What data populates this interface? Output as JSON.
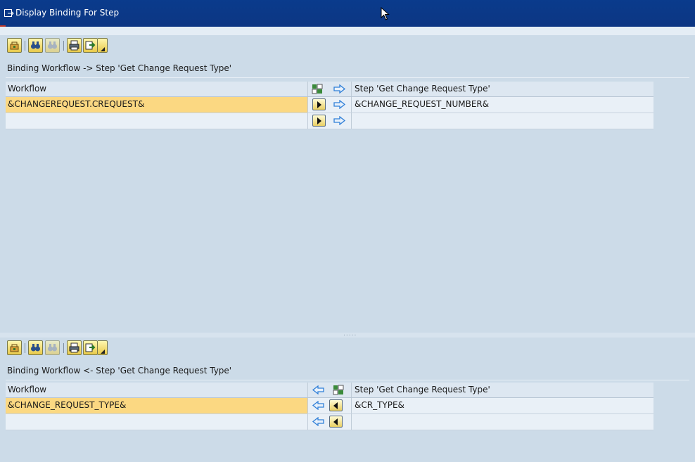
{
  "window": {
    "title": "Display Binding For Step"
  },
  "panels": [
    {
      "id": "import",
      "toolbar": [
        "details-icon",
        "find-icon",
        "find-next-icon",
        "print-icon",
        "export-icon"
      ],
      "binding_label": "Binding Workflow  -> Step 'Get Change Request Type'",
      "header": {
        "left": "Workflow",
        "right": "Step 'Get Change Request Type'"
      },
      "rows": [
        {
          "left": "&CHANGEREQUEST.CREQUEST&",
          "right": "&CHANGE_REQUEST_NUMBER&",
          "selected": true
        },
        {
          "left": "",
          "right": "",
          "selected": false
        }
      ]
    },
    {
      "id": "export",
      "toolbar": [
        "details-icon",
        "find-icon",
        "find-next-icon",
        "print-icon",
        "export-icon"
      ],
      "binding_label": "Binding Workflow  <- Step 'Get Change Request Type'",
      "header": {
        "left": "Workflow",
        "right": "Step 'Get Change Request Type'"
      },
      "rows": [
        {
          "left": "&CHANGE_REQUEST_TYPE&",
          "right": "&CR_TYPE&",
          "selected": true
        },
        {
          "left": "",
          "right": "",
          "selected": false
        }
      ]
    }
  ],
  "colors": {
    "title_bar": "#0c3683",
    "panel_bg": "#ccdbe8",
    "selected_cell": "#fbd882",
    "arrow": "#2f7fd8"
  }
}
